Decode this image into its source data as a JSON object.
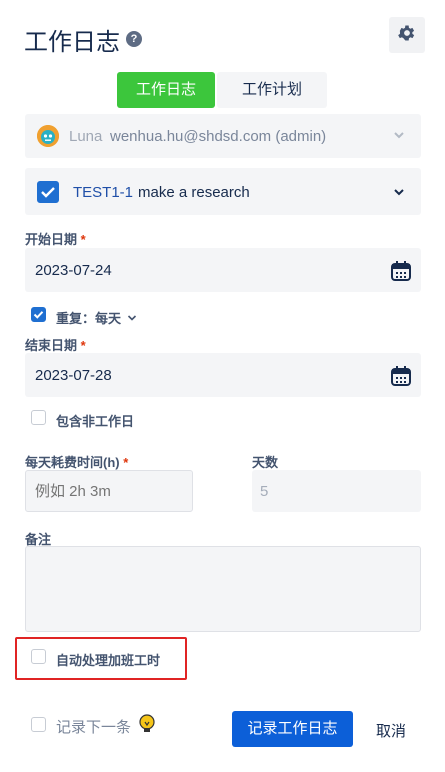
{
  "header": {
    "title": "工作日志",
    "help_icon_text": "?"
  },
  "tabs": [
    {
      "label": "工作日志",
      "active": true
    },
    {
      "label": "工作计划",
      "active": false
    }
  ],
  "user": {
    "name": "Luna",
    "email": "wenhua.hu@shdsd.com (admin)"
  },
  "task": {
    "key": "TEST1-1",
    "summary": "make a research",
    "checked": true
  },
  "start_date": {
    "label": "开始日期",
    "required": "*",
    "value": "2023-07-24"
  },
  "repeat": {
    "checked": true,
    "label": "重复：每天"
  },
  "end_date": {
    "label": "结束日期",
    "required": "*",
    "value": "2023-07-28"
  },
  "include_nonworking": {
    "checked": false,
    "label": "包含非工作日"
  },
  "daily_time": {
    "label": "每天耗费时间(h)",
    "required": "*",
    "placeholder": "例如 2h 3m"
  },
  "days": {
    "label": "天数",
    "value": "5"
  },
  "note": {
    "label": "备注",
    "value": ""
  },
  "auto_overtime": {
    "checked": false,
    "label": "自动处理加班工时"
  },
  "log_next": {
    "checked": false,
    "label": "记录下一条"
  },
  "actions": {
    "submit": "记录工作日志",
    "cancel": "取消"
  },
  "colors": {
    "accent_green": "#3cc63c",
    "primary_blue": "#0c5fd8",
    "highlight_red": "#e02424"
  }
}
